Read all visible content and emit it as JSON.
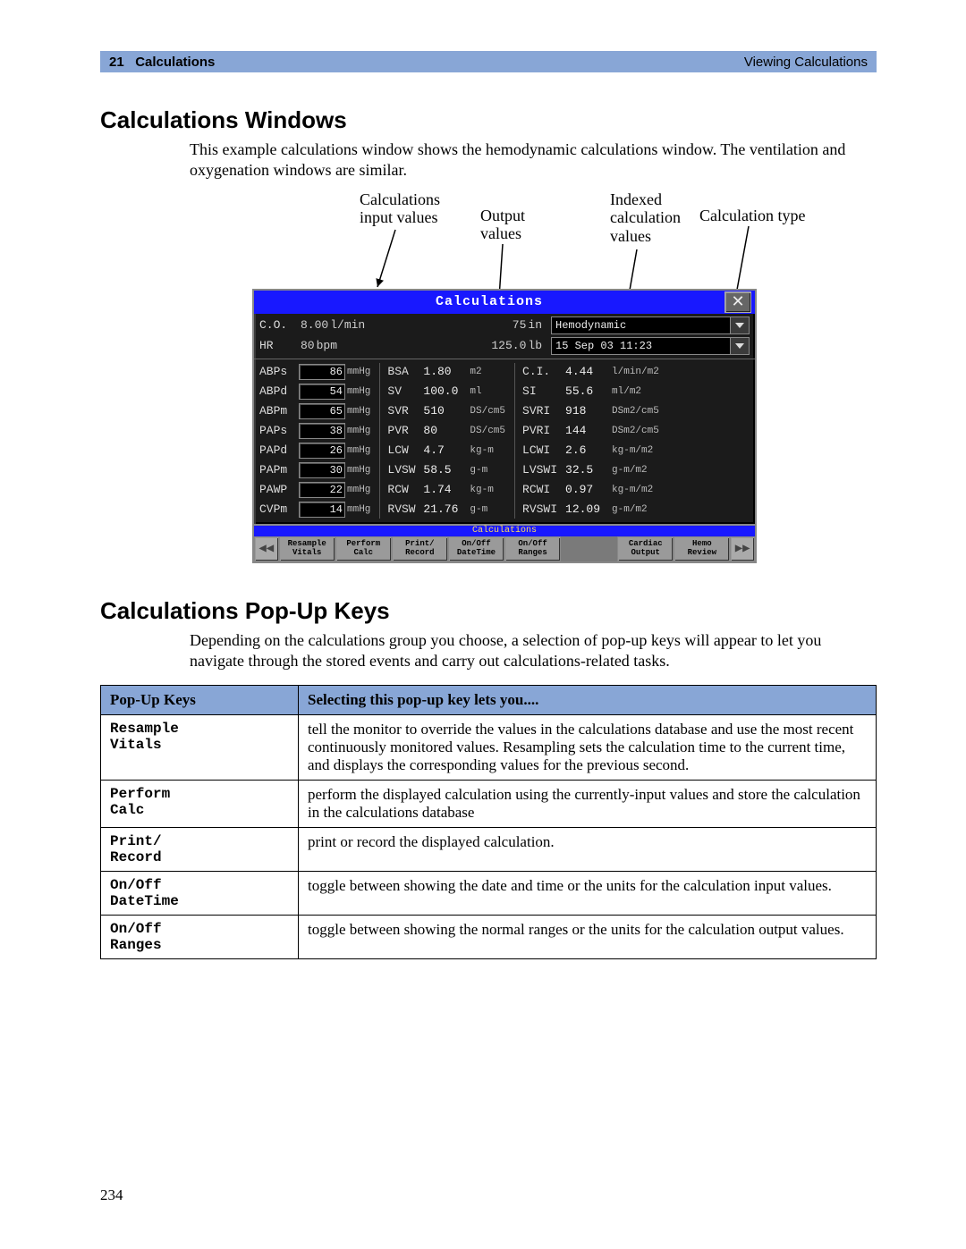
{
  "header": {
    "chapter_num": "21",
    "chapter_title": "Calculations",
    "running_right": "Viewing Calculations"
  },
  "section1": {
    "title": "Calculations Windows",
    "para": "This example calculations window shows the hemodynamic calculations window. The ventilation and oxygenation windows are similar."
  },
  "callouts": {
    "c1": "Calculations\ninput values",
    "c2": "Output\nvalues",
    "c3": "Indexed\ncalculation\nvalues",
    "c4": "Calculation type"
  },
  "calcwin": {
    "title": "Calculations",
    "close": "✕",
    "top": {
      "height_val": "75",
      "height_unit": "in",
      "calc_type": "Hemodynamic",
      "weight_val": "125.0",
      "weight_unit": "lb",
      "datetime": "15 Sep 03 11:23"
    },
    "inputs": [
      {
        "label": "C.O.",
        "value": "8.00",
        "unit": "l/min"
      },
      {
        "label": "HR",
        "value": "80",
        "unit": "bpm"
      },
      {
        "label": "ABPs",
        "value": "86",
        "unit": "mmHg"
      },
      {
        "label": "ABPd",
        "value": "54",
        "unit": "mmHg"
      },
      {
        "label": "ABPm",
        "value": "65",
        "unit": "mmHg"
      },
      {
        "label": "PAPs",
        "value": "38",
        "unit": "mmHg"
      },
      {
        "label": "PAPd",
        "value": "26",
        "unit": "mmHg"
      },
      {
        "label": "PAPm",
        "value": "30",
        "unit": "mmHg"
      },
      {
        "label": "PAWP",
        "value": "22",
        "unit": "mmHg"
      },
      {
        "label": "CVPm",
        "value": "14",
        "unit": "mmHg"
      }
    ],
    "outputs": [
      {
        "label": "BSA",
        "value": "1.80",
        "unit": "m2"
      },
      {
        "label": "SV",
        "value": "100.0",
        "unit": "ml"
      },
      {
        "label": "SVR",
        "value": "510",
        "unit": "DS/cm5"
      },
      {
        "label": "PVR",
        "value": "80",
        "unit": "DS/cm5"
      },
      {
        "label": "LCW",
        "value": "4.7",
        "unit": "kg-m"
      },
      {
        "label": "LVSW",
        "value": "58.5",
        "unit": "g-m"
      },
      {
        "label": "RCW",
        "value": "1.74",
        "unit": "kg-m"
      },
      {
        "label": "RVSW",
        "value": "21.76",
        "unit": "g-m"
      }
    ],
    "indexed": [
      {
        "label": "C.I.",
        "value": "4.44",
        "unit": "l/min/m2"
      },
      {
        "label": "SI",
        "value": "55.6",
        "unit": "ml/m2"
      },
      {
        "label": "SVRI",
        "value": "918",
        "unit": "DSm2/cm5"
      },
      {
        "label": "PVRI",
        "value": "144",
        "unit": "DSm2/cm5"
      },
      {
        "label": "LCWI",
        "value": "2.6",
        "unit": "kg-m/m2"
      },
      {
        "label": "LVSWI",
        "value": "32.5",
        "unit": "g-m/m2"
      },
      {
        "label": "RCWI",
        "value": "0.97",
        "unit": "kg-m/m2"
      },
      {
        "label": "RVSWI",
        "value": "12.09",
        "unit": "g-m/m2"
      }
    ],
    "popbar_title": "Calculations",
    "keys": [
      {
        "l1": "Resample",
        "l2": "Vitals"
      },
      {
        "l1": "Perform",
        "l2": "Calc"
      },
      {
        "l1": "Print/",
        "l2": "Record"
      },
      {
        "l1": "On/Off",
        "l2": "DateTime"
      },
      {
        "l1": "On/Off",
        "l2": "Ranges"
      },
      {
        "gap": true
      },
      {
        "l1": "Cardiac",
        "l2": "Output"
      },
      {
        "l1": "Hemo",
        "l2": "Review"
      }
    ],
    "arrow_left": "◀◀",
    "arrow_right": "▶▶"
  },
  "section2": {
    "title": "Calculations Pop-Up Keys",
    "para": "Depending on the calculations group you choose, a selection of pop-up keys will appear to let you navigate through the stored events and carry out calculations-related tasks."
  },
  "table": {
    "head1": "Pop-Up Keys",
    "head2": "Selecting this pop-up key lets you....",
    "rows": [
      {
        "k": "Resample\nVitals",
        "d": "tell the monitor to override the values in the calculations database and use the most recent continuously monitored values. Resampling sets the calculation time to the current time, and displays the corresponding values for the previous second."
      },
      {
        "k": "Perform\nCalc",
        "d": "perform the displayed calculation using the currently-input values and store the calculation in the calculations database"
      },
      {
        "k": "Print/\nRecord",
        "d": "print or record the displayed calculation."
      },
      {
        "k": "On/Off\nDateTime",
        "d": "toggle between showing the date and time or the units for the calculation input values."
      },
      {
        "k": "On/Off\nRanges",
        "d": "toggle between showing the normal ranges or the units for the calculation output values."
      }
    ]
  },
  "page_number": "234"
}
